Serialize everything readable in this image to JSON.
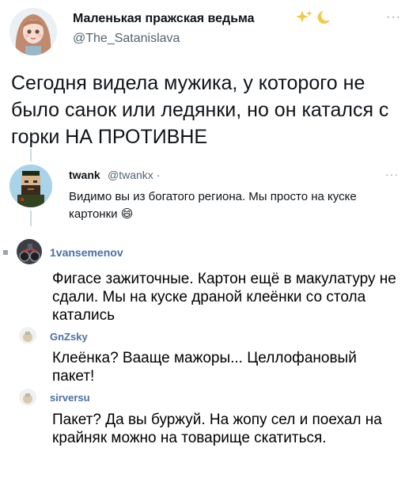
{
  "tweet": {
    "author_name": "Маленькая пражская ведьма",
    "author_handle": "@The_Satanislava",
    "text": "Сегодня видела мужика, у которого не было санок или ледянки, но он катался с горки НА ПРОТИВНЕ",
    "more_label": "···"
  },
  "reply": {
    "author_name": "twank",
    "author_handle": "@twankx ·",
    "text": "Видимо вы из богатого региона. Мы просто на куске картонки",
    "emoji": "😄",
    "more_label": "···"
  },
  "comments": [
    {
      "author": "1vansemenov",
      "text": "Фигасе зажиточные. Картон ещё в макулатуру не сдали. Мы на куске драной клеёнки со стола катались"
    },
    {
      "author": "GnZsky",
      "text": "Клеёнка? Вааще мажоры... Целлофановый пакет!"
    },
    {
      "author": "sirversu",
      "text": "Пакет? Да вы буржуй. На жопу сел и поехал на крайняк можно на товарище скатиться."
    }
  ],
  "colors": {
    "text": "#0f1419",
    "secondary": "#536471",
    "comment_author": "#4a6fa5",
    "thread_line": "#cfd9de"
  },
  "icons": {
    "decoration": "sparkles-moon-icon",
    "more": "more-horizontal-icon"
  }
}
